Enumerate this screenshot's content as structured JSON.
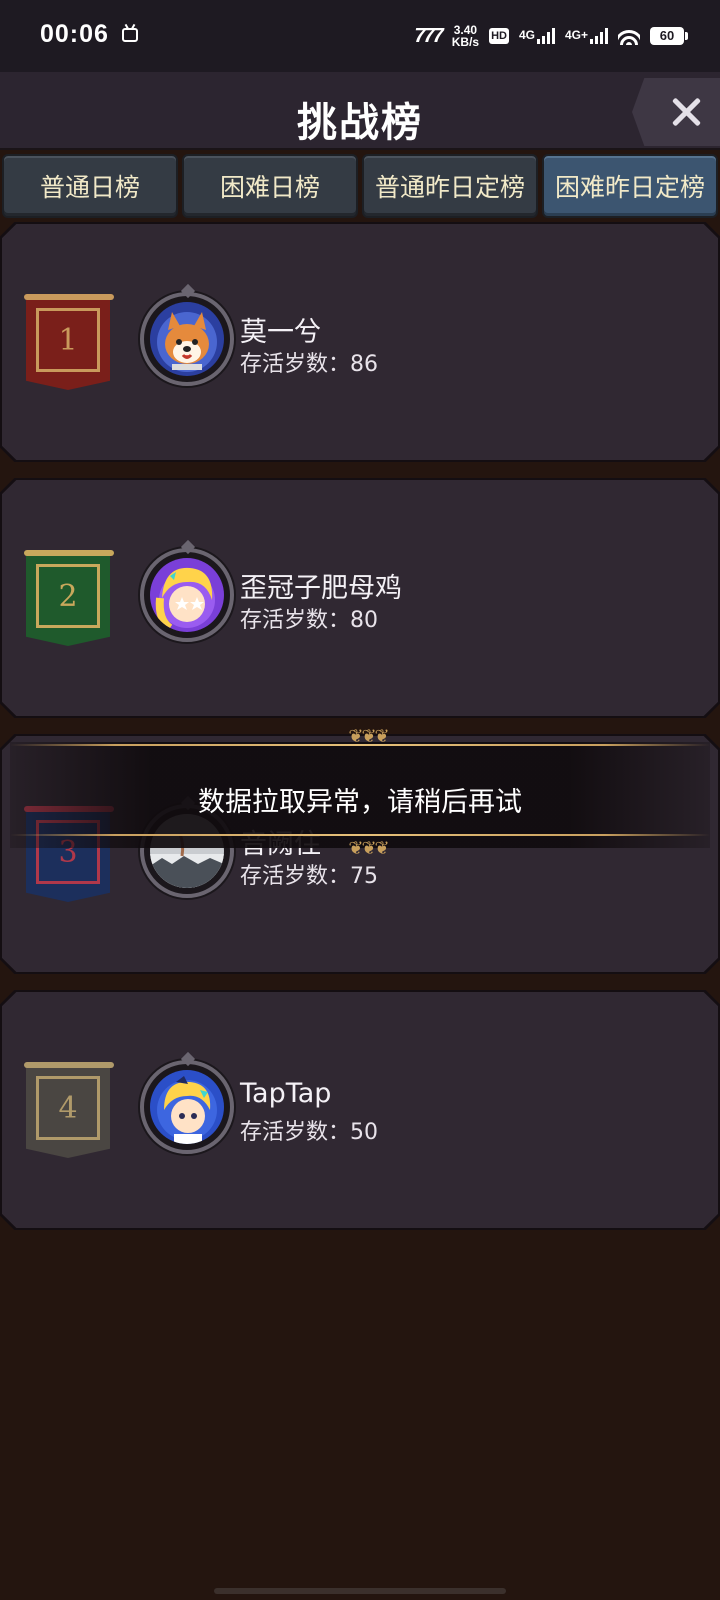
{
  "status_bar": {
    "time": "00:06",
    "speed_value": "3.40",
    "speed_unit": "KB/s",
    "hd_label": "HD",
    "network1": "4G",
    "network2": "4G+",
    "battery": "60"
  },
  "header": {
    "title": "挑战榜"
  },
  "tabs": [
    {
      "label": "普通日榜",
      "active": false
    },
    {
      "label": "困难日榜",
      "active": false
    },
    {
      "label": "普通昨日定榜",
      "active": false
    },
    {
      "label": "困难昨日定榜",
      "active": true
    }
  ],
  "score_prefix": "存活岁数：",
  "leaderboard": [
    {
      "rank": "1",
      "name": "莫一兮",
      "score_label": "存活岁数：86",
      "banner_color": "#7a1f1a",
      "frame_color": "#c99a5c",
      "avatar": "shiba-dog-avatar"
    },
    {
      "rank": "2",
      "name": "歪冠子肥母鸡",
      "score_label": "存活岁数：80",
      "banner_color": "#1f5a2c",
      "frame_color": "#c9a85c",
      "avatar": "anime-girl-avatar"
    },
    {
      "rank": "3",
      "name": "音阙住",
      "score_label": "存活岁数：75",
      "banner_color": "#1c2f5c",
      "frame_color": "#b0384a",
      "avatar": "landscape-avatar"
    },
    {
      "rank": "4",
      "name": "TapTap",
      "score_label": "存活岁数：50",
      "banner_color": "#4a4642",
      "frame_color": "#b09a6a",
      "avatar": "taptap-mascot-avatar"
    }
  ],
  "toast": {
    "message": "数据拉取异常，请稍后再试"
  }
}
